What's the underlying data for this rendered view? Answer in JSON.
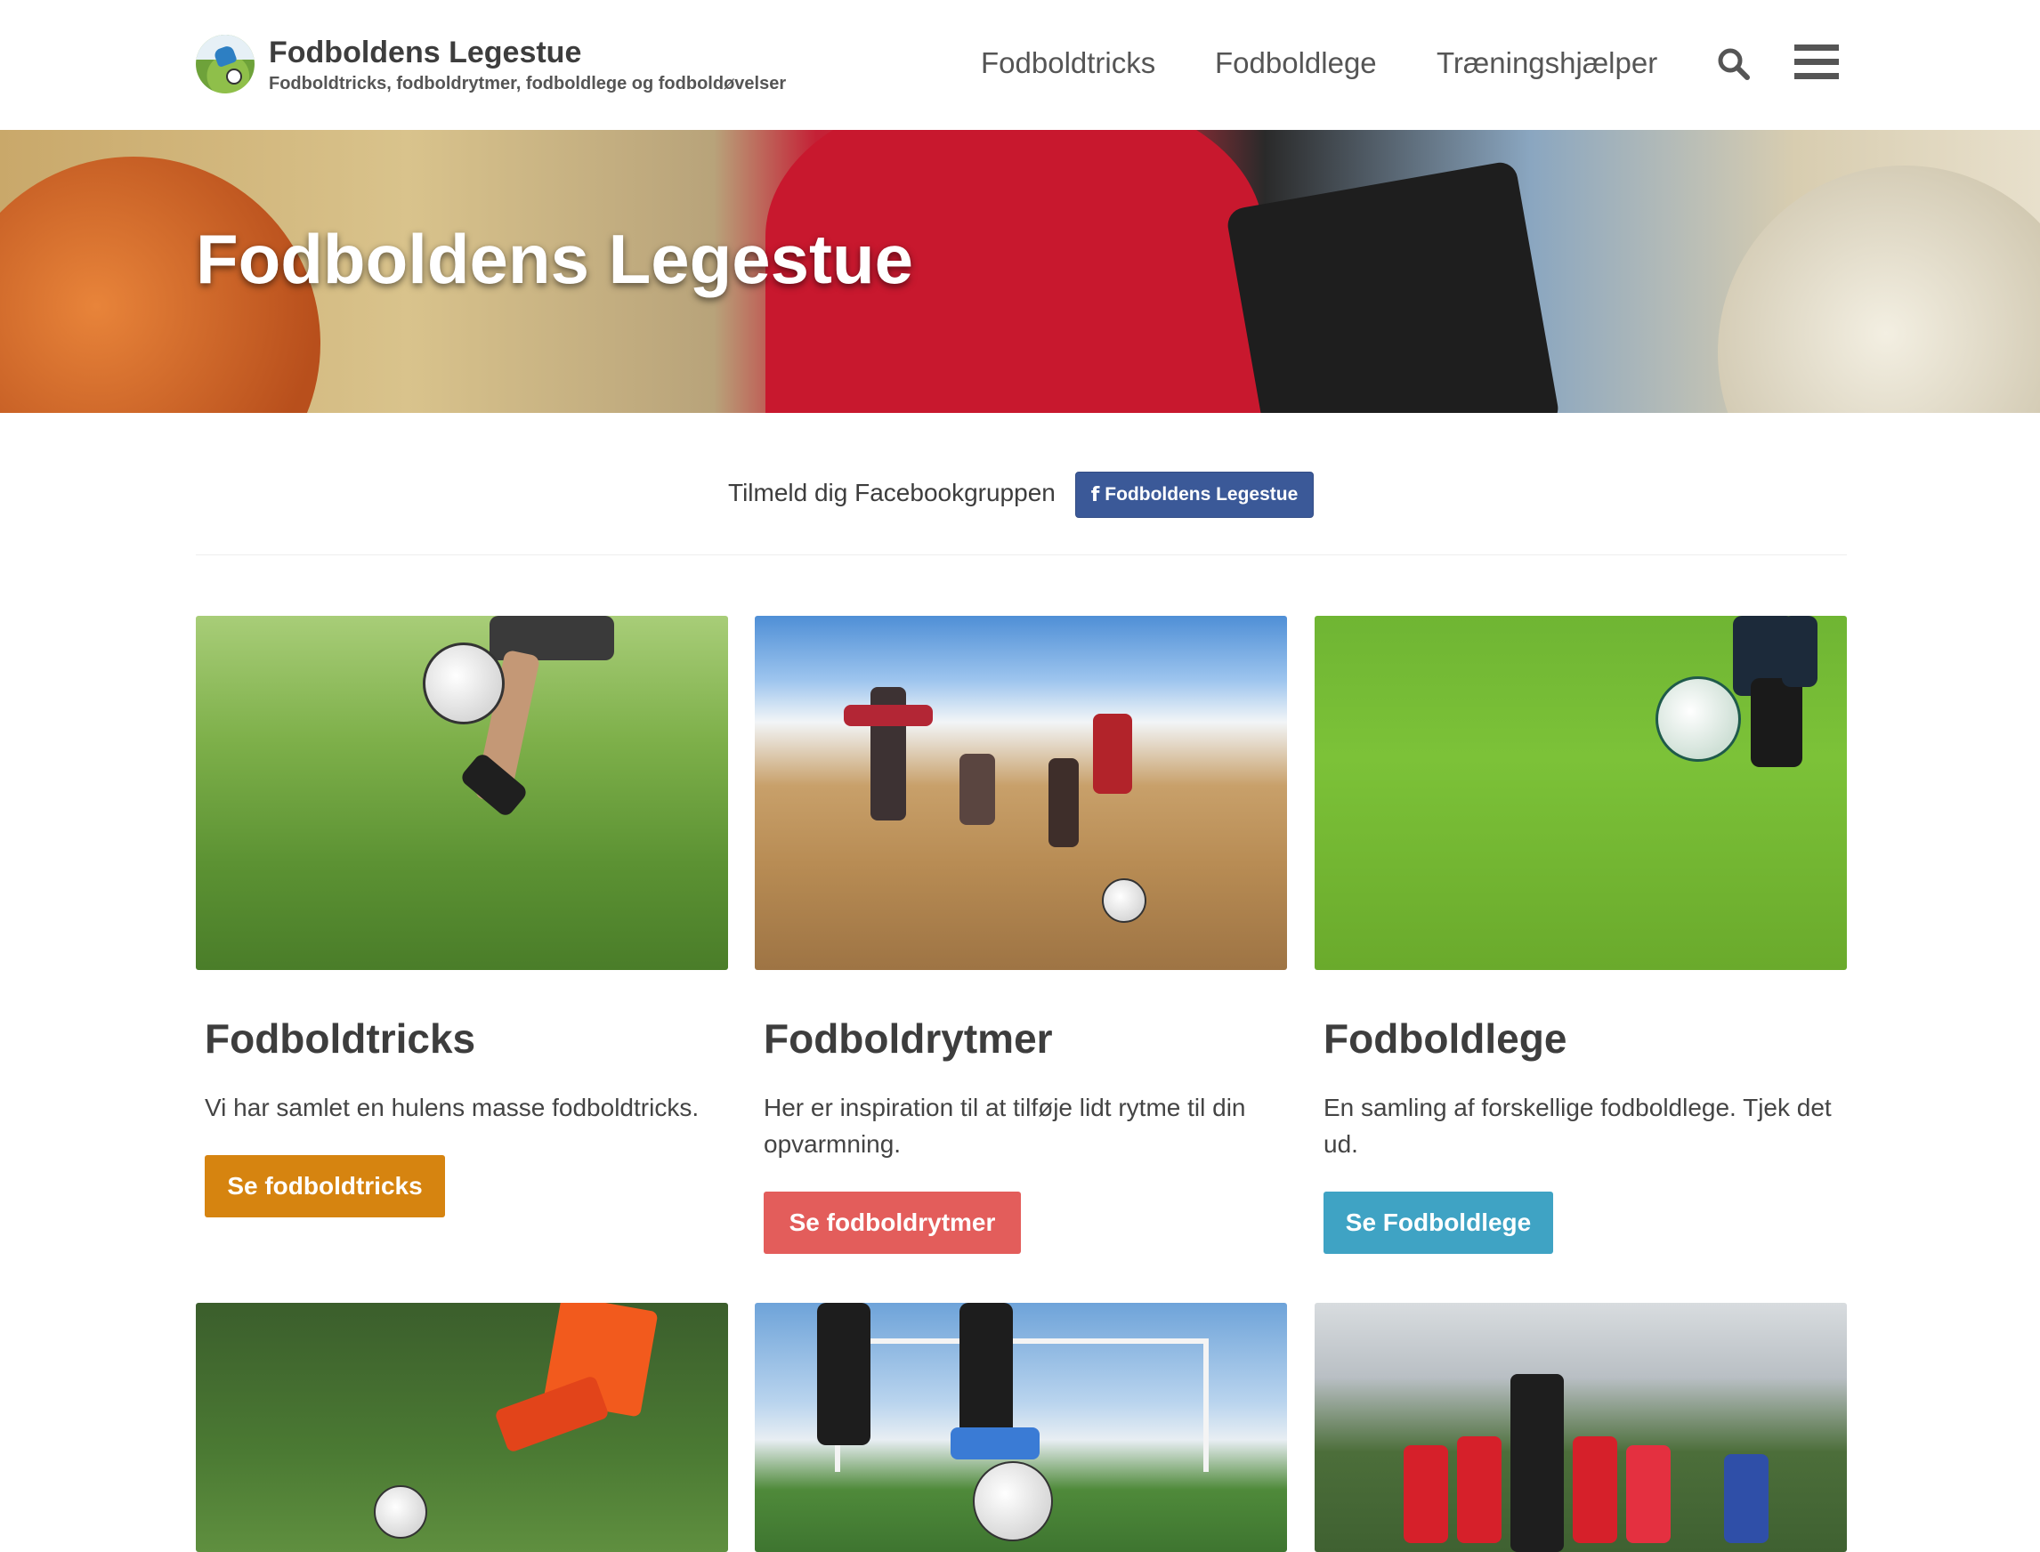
{
  "header": {
    "site_title": "Fodboldens Legestue",
    "site_subtitle": "Fodboldtricks, fodboldrytmer, fodboldlege og fodboldøvelser",
    "nav": [
      {
        "label": "Fodboldtricks"
      },
      {
        "label": "Fodboldlege"
      },
      {
        "label": "Træningshjælper"
      }
    ],
    "search_icon": "search-icon",
    "menu_icon": "hamburger-menu-icon"
  },
  "hero": {
    "title": "Fodboldens Legestue"
  },
  "facebook": {
    "text": "Tilmeld dig Facebookgruppen",
    "button_icon": "f",
    "button_label": "Fodboldens Legestue",
    "color": "#3b5998"
  },
  "cards": [
    {
      "title": "Fodboldtricks",
      "text": "Vi har samlet en hulens masse fodboldtricks.",
      "button": "Se fodboldtricks",
      "button_color": "#d68410"
    },
    {
      "title": "Fodboldrytmer",
      "text": "Her er inspiration til at tilføje lidt rytme til din opvarmning.",
      "button": "Se fodboldrytmer",
      "button_color": "#e35d5b"
    },
    {
      "title": "Fodboldlege",
      "text": "En samling af forskellige fodboldlege. Tjek det ud.",
      "button": "Se Fodboldlege",
      "button_color": "#3fa3c4"
    }
  ]
}
